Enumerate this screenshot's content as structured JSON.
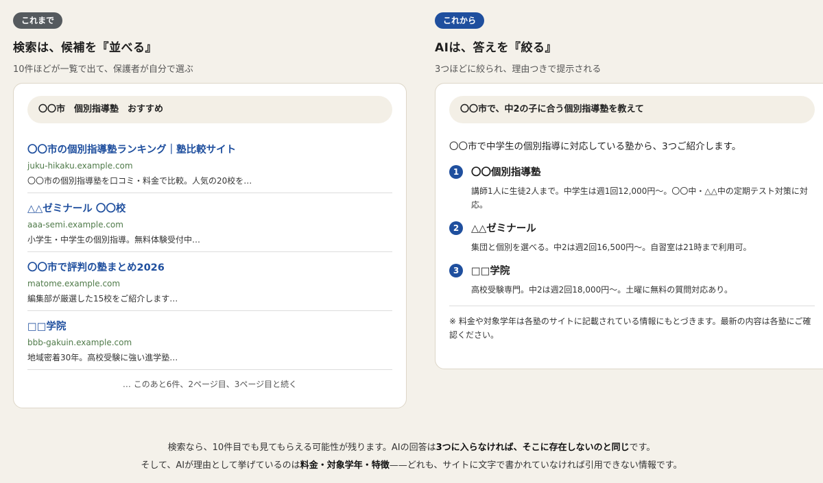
{
  "before": {
    "badge": "これまで",
    "heading": "検索は、候補を『並べる』",
    "subheading": "10件ほどが一覧で出て、保護者が自分で選ぶ",
    "query": "〇〇市　個別指導塾　おすすめ",
    "results": [
      {
        "title": "〇〇市の個別指導塾ランキング｜塾比較サイト",
        "url": "juku-hikaku.example.com",
        "snippet": "〇〇市の個別指導塾を口コミ・料金で比較。人気の20校を…"
      },
      {
        "title": "△△ゼミナール 〇〇校",
        "url": "aaa-semi.example.com",
        "snippet": "小学生・中学生の個別指導。無料体験受付中…"
      },
      {
        "title": "〇〇市で評判の塾まとめ2026",
        "url": "matome.example.com",
        "snippet": "編集部が厳選した15校をご紹介します…"
      },
      {
        "title": "□□学院",
        "url": "bbb-gakuin.example.com",
        "snippet": "地域密着30年。高校受験に強い進学塾…"
      }
    ],
    "more": "… このあと6件、2ページ目、3ページ目と続く"
  },
  "after": {
    "badge": "これから",
    "heading": "AIは、答えを『絞る』",
    "subheading": "3つほどに絞られ、理由つきで提示される",
    "query": "〇〇市で、中2の子に合う個別指導塾を教えて",
    "intro": "〇〇市で中学生の個別指導に対応している塾から、3つご紹介します。",
    "answers": [
      {
        "num": "1",
        "name": "〇〇個別指導塾",
        "desc": "講師1人に生徒2人まで。中学生は週1回12,000円〜。〇〇中・△△中の定期テスト対策に対応。"
      },
      {
        "num": "2",
        "name": "△△ゼミナール",
        "desc": "集団と個別を選べる。中2は週2回16,500円〜。自習室は21時まで利用可。"
      },
      {
        "num": "3",
        "name": "□□学院",
        "desc": "高校受験専門。中2は週2回18,000円〜。土曜に無料の質問対応あり。"
      }
    ],
    "note": "※ 料金や対象学年は各塾のサイトに記載されている情報にもとづきます。最新の内容は各塾にご確認ください。"
  },
  "footer": {
    "line1_a": "検索なら、10件目でも見てもらえる可能性が残ります。AIの回答は",
    "line1_b": "3つに入らなければ、そこに存在しないのと同じ",
    "line1_c": "です。",
    "line2_a": "そして、AIが理由として挙げているのは",
    "line2_b": "料金・対象学年・特徴",
    "line2_c": "——どれも、サイトに文字で書かれていなければ引用できない情報です。"
  },
  "colors": {
    "accent": "#1f4f9e",
    "badge_gray": "#555a5e",
    "url_green": "#4f7a49",
    "background": "#f4f1ea"
  }
}
